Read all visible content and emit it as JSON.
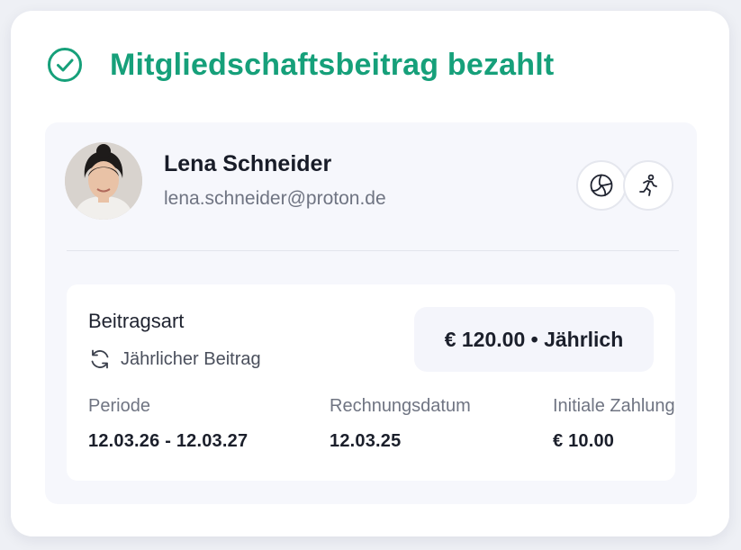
{
  "header": {
    "title": "Mitgliedschaftsbeitrag bezahlt",
    "status_icon": "check-circle-icon",
    "accent_color": "#16a07a"
  },
  "member": {
    "name": "Lena Schneider",
    "email": "lena.schneider@proton.de",
    "sport_icons": [
      "volleyball-icon",
      "running-icon"
    ]
  },
  "fee": {
    "type_label": "Beitragsart",
    "type_value": "Jährlicher Beitrag",
    "type_icon": "refresh-icon",
    "amount": "€ 120.00 • Jährlich"
  },
  "details": [
    {
      "label": "Periode",
      "value": "12.03.26 - 12.03.27"
    },
    {
      "label": "Rechnungsdatum",
      "value": "12.03.25"
    },
    {
      "label": "Initiale Zahlung",
      "value": "€ 10.00"
    }
  ]
}
